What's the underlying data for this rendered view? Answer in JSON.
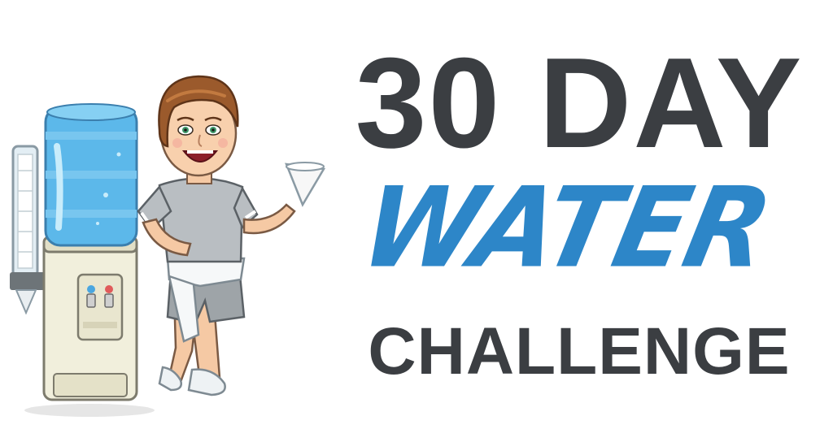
{
  "title": {
    "line1": "30 DAY",
    "line2": "WATER",
    "line3": "CHALLENGE"
  },
  "colors": {
    "dark_text": "#3b3e42",
    "water_blue": "#2d86c8",
    "background": "#ffffff"
  },
  "illustration": {
    "icon": "cartoon-woman-at-water-cooler"
  }
}
